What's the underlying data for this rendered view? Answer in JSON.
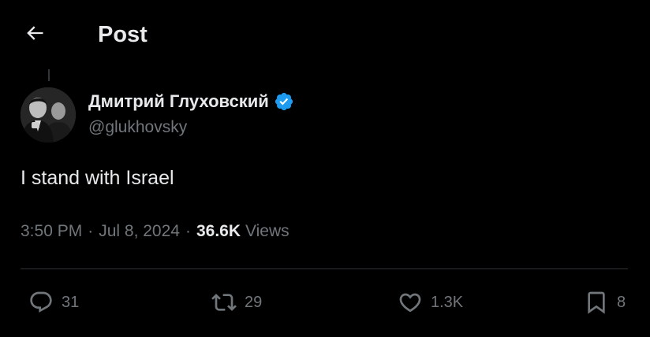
{
  "header": {
    "title": "Post",
    "back_icon": "arrow-left-icon"
  },
  "author": {
    "name": "Дмитрий Глуховский",
    "handle": "@glukhovsky",
    "verified": true,
    "verified_color": "#1d9bf0"
  },
  "post": {
    "text": "I stand with Israel",
    "time": "3:50 PM",
    "date": "Jul 8, 2024",
    "views_count": "36.6K",
    "views_label": "Views"
  },
  "actions": {
    "reply": {
      "icon": "reply-icon",
      "count": "31"
    },
    "repost": {
      "icon": "repost-icon",
      "count": "29"
    },
    "like": {
      "icon": "heart-icon",
      "count": "1.3K"
    },
    "bookmark": {
      "icon": "bookmark-icon",
      "count": "8"
    }
  },
  "colors": {
    "background": "#000000",
    "text_primary": "#e7e9ea",
    "text_secondary": "#71767b",
    "divider": "#2f3336"
  }
}
